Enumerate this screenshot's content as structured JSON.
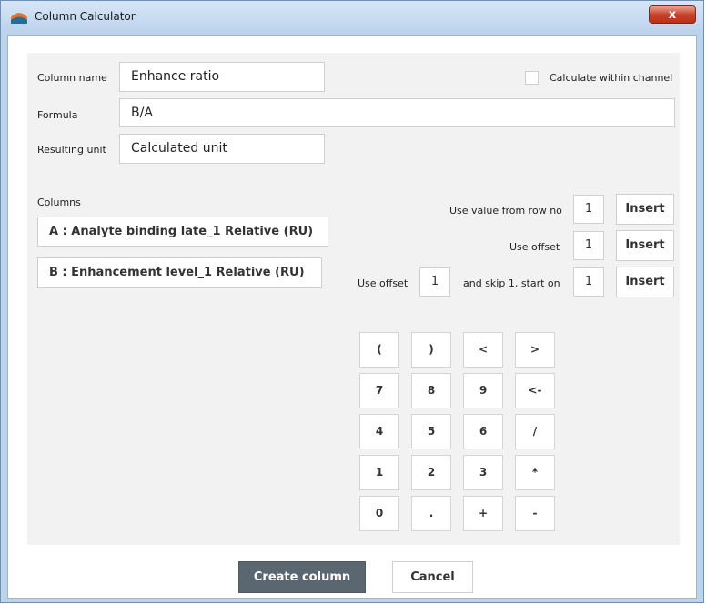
{
  "window": {
    "title": "Column Calculator",
    "close_glyph": "x",
    "app_icon": "column-calculator-icon"
  },
  "form": {
    "column_name_label": "Column name",
    "column_name_value": "Enhance ratio",
    "calc_within_channel_label": "Calculate within channel",
    "formula_label": "Formula",
    "formula_value": "B/A",
    "resulting_unit_label": "Resulting unit",
    "resulting_unit_value": "Calculated unit"
  },
  "columns": {
    "label": "Columns",
    "items": [
      {
        "label": "A : Analyte binding late_1 Relative (RU)"
      },
      {
        "label": "B : Enhancement  level_1 Relative (RU)"
      }
    ]
  },
  "inserts": {
    "row_label": "Use value from row no",
    "row_value": "1",
    "offset_label": "Use offset",
    "offset_value": "1",
    "skip_offset_label": "Use offset",
    "skip_offset_value": "1",
    "skip_label": "and skip  1, start on",
    "skip_value": "1",
    "insert_label": "Insert"
  },
  "keypad": [
    "(",
    ")",
    "<",
    ">",
    "7",
    "8",
    "9",
    "<-",
    "4",
    "5",
    "6",
    "/",
    "1",
    "2",
    "3",
    "*",
    "0",
    ".",
    "+",
    "-"
  ],
  "footer": {
    "create_label": "Create column",
    "cancel_label": "Cancel"
  }
}
